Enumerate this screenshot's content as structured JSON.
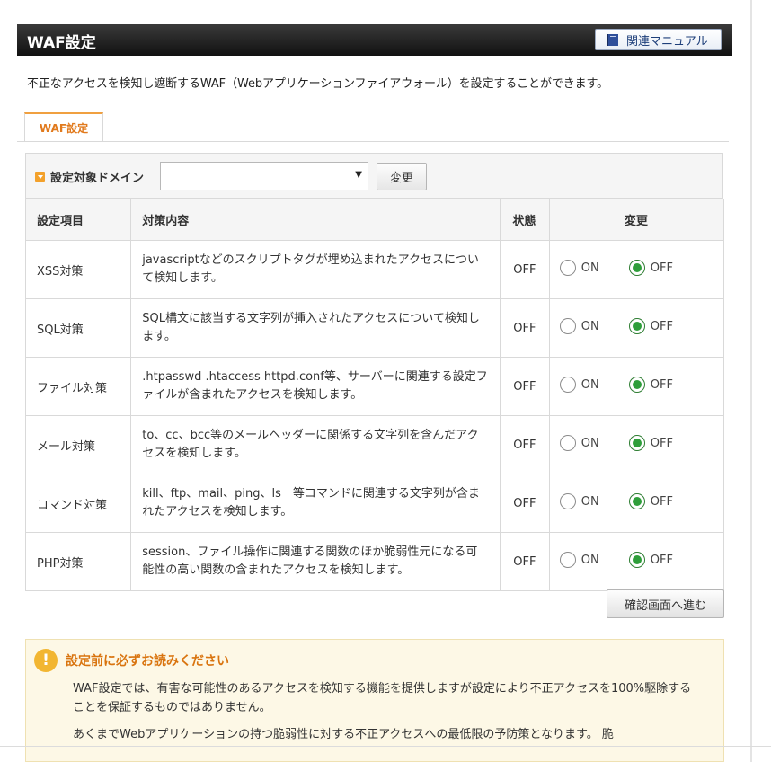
{
  "header": {
    "title": "WAF設定",
    "manual_label": "関連マニュアル"
  },
  "intro": "不正なアクセスを検知し遮断するWAF（Webアプリケーションファイアウォール）を設定することができます。",
  "tab": {
    "label": "WAF設定"
  },
  "domain": {
    "label": "設定対象ドメイン",
    "selected_value": "",
    "change_label": "変更"
  },
  "table": {
    "headers": [
      "設定項目",
      "対策内容",
      "状態",
      "変更"
    ],
    "on_label": "ON",
    "off_label": "OFF",
    "rows": [
      {
        "item": "XSS対策",
        "desc": "javascriptなどのスクリプトタグが埋め込まれたアクセスについて検知します。",
        "status": "OFF",
        "selected": "OFF"
      },
      {
        "item": "SQL対策",
        "desc": "SQL構文に該当する文字列が挿入されたアクセスについて検知します。",
        "status": "OFF",
        "selected": "OFF"
      },
      {
        "item": "ファイル対策",
        "desc": ".htpasswd .htaccess httpd.conf等、サーバーに関連する設定ファイルが含まれたアクセスを検知します。",
        "status": "OFF",
        "selected": "OFF"
      },
      {
        "item": "メール対策",
        "desc": "to、cc、bcc等のメールヘッダーに関係する文字列を含んだアクセスを検知します。",
        "status": "OFF",
        "selected": "OFF"
      },
      {
        "item": "コマンド対策",
        "desc": "kill、ftp、mail、ping、ls　等コマンドに関連する文字列が含まれたアクセスを検知します。",
        "status": "OFF",
        "selected": "OFF"
      },
      {
        "item": "PHP対策",
        "desc": "session、ファイル操作に関連する関数のほか脆弱性元になる可能性の高い関数の含まれたアクセスを検知します。",
        "status": "OFF",
        "selected": "OFF"
      }
    ]
  },
  "confirm_label": "確認画面へ進む",
  "notice": {
    "icon": "!",
    "title": "設定前に必ずお読みください",
    "paragraph1": "WAF設定では、有害な可能性のあるアクセスを検知する機能を提供しますが設定により不正アクセスを100%駆除することを保証するものではありません。",
    "paragraph2": "あくまでWebアプリケーションの持つ脆弱性に対する不正アクセスへの最低限の予防策となります。 脆"
  }
}
